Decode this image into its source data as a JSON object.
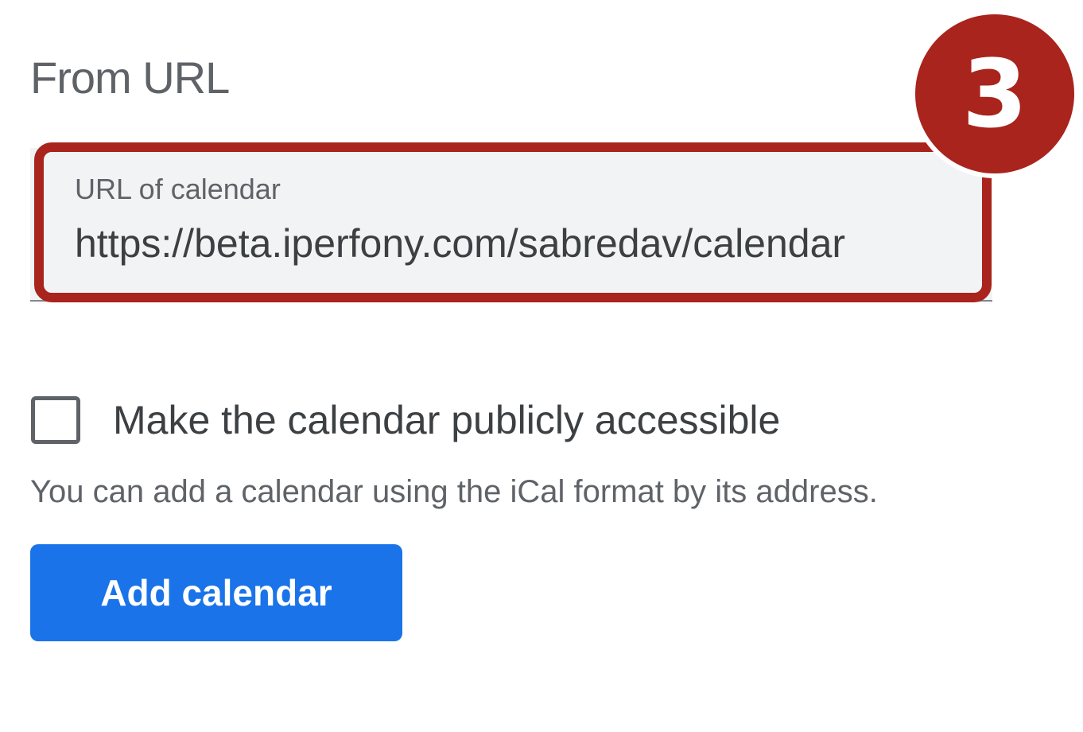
{
  "section": {
    "title": "From URL"
  },
  "url_field": {
    "label": "URL of calendar",
    "value": "https://beta.iperfony.com/sabredav/calendar"
  },
  "annotation": {
    "step_number": "3",
    "accent_color": "#a8241d"
  },
  "public_option": {
    "checked": false,
    "label": "Make the calendar publicly accessible"
  },
  "helper": {
    "text": "You can add a calendar using the iCal format by its address."
  },
  "actions": {
    "add_label": "Add calendar",
    "add_color": "#1a73e8"
  }
}
